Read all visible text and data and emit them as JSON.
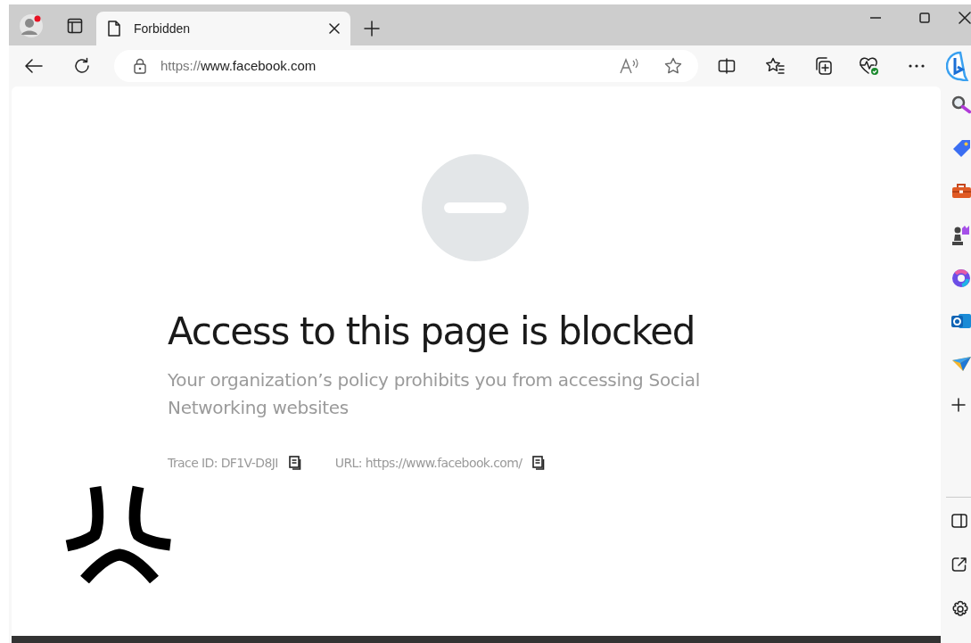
{
  "tab": {
    "title": "Forbidden",
    "selected": true
  },
  "address": {
    "scheme": "https://",
    "host": "www.facebook.com"
  },
  "page": {
    "heading": "Access to this page is blocked",
    "message": "Your organization’s policy prohibits you from accessing Social Networking websites",
    "details": [
      {
        "text": "Trace ID: DF1V-D8JI"
      },
      {
        "text": "URL: https://www.facebook.com/"
      }
    ]
  }
}
